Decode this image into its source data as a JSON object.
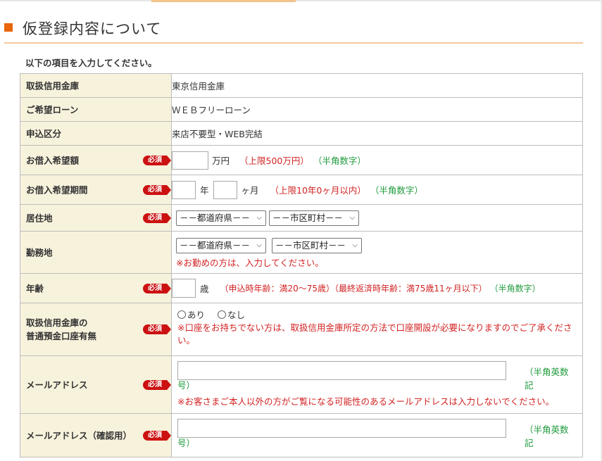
{
  "page": {
    "title": "仮登録内容について",
    "intro": "以下の項目を入力してください。"
  },
  "colors": {
    "accent": "#e8660c",
    "label_bg": "#f7f2dc",
    "required": "#cc1111",
    "note_red": "#d22222",
    "note_green": "#1f9a3c"
  },
  "rows": {
    "bank": {
      "label": "取扱信用金庫",
      "value": "東京信用金庫"
    },
    "loan": {
      "label": "ご希望ローン",
      "value": "ＷＥＢフリーローン"
    },
    "type": {
      "label": "申込区分",
      "value": "来店不要型・WEB完結"
    },
    "amount": {
      "label": "お借入希望額",
      "required": "必須",
      "unit": "万円",
      "limit": "（上限500万円）",
      "hint": "（半角数字）"
    },
    "period": {
      "label": "お借入希望期間",
      "required": "必須",
      "year_unit": "年",
      "month_unit": "ヶ月",
      "limit": "（上限10年0ヶ月以内）",
      "hint": "（半角数字）"
    },
    "residence": {
      "label": "居住地",
      "required": "必須",
      "pref_placeholder": "－－都道府県－－",
      "city_placeholder": "－－市区町村－－"
    },
    "workplace": {
      "label": "勤務地",
      "pref_placeholder": "－－都道府県－－",
      "city_placeholder": "－－市区町村－－",
      "note": "※お勤めの方は、入力してください。"
    },
    "age": {
      "label": "年齢",
      "required": "必須",
      "unit": "歳",
      "limit": "（申込時年齢：満20～75歳）（最終返済時年齢：満75歳11ヶ月以下）",
      "hint": "（半角数字）"
    },
    "account": {
      "label_line1": "取扱信用金庫の",
      "label_line2": "普通預金口座有無",
      "required": "必須",
      "option_yes": "あり",
      "option_no": "なし",
      "note": "※口座をお持ちでない方は、取扱信用金庫所定の方法で口座開設が必要になりますのでご了承ください。"
    },
    "email": {
      "label": "メールアドレス",
      "required": "必須",
      "hint_a": "（半角英数記",
      "hint_b": "号）",
      "note": "※お客さまご本人以外の方がご覧になる可能性のあるメールアドレスは入力しないでください。"
    },
    "email_confirm": {
      "label": "メールアドレス（確認用）",
      "required": "必須",
      "hint_a": "（半角英数記",
      "hint_b": "号）"
    }
  }
}
